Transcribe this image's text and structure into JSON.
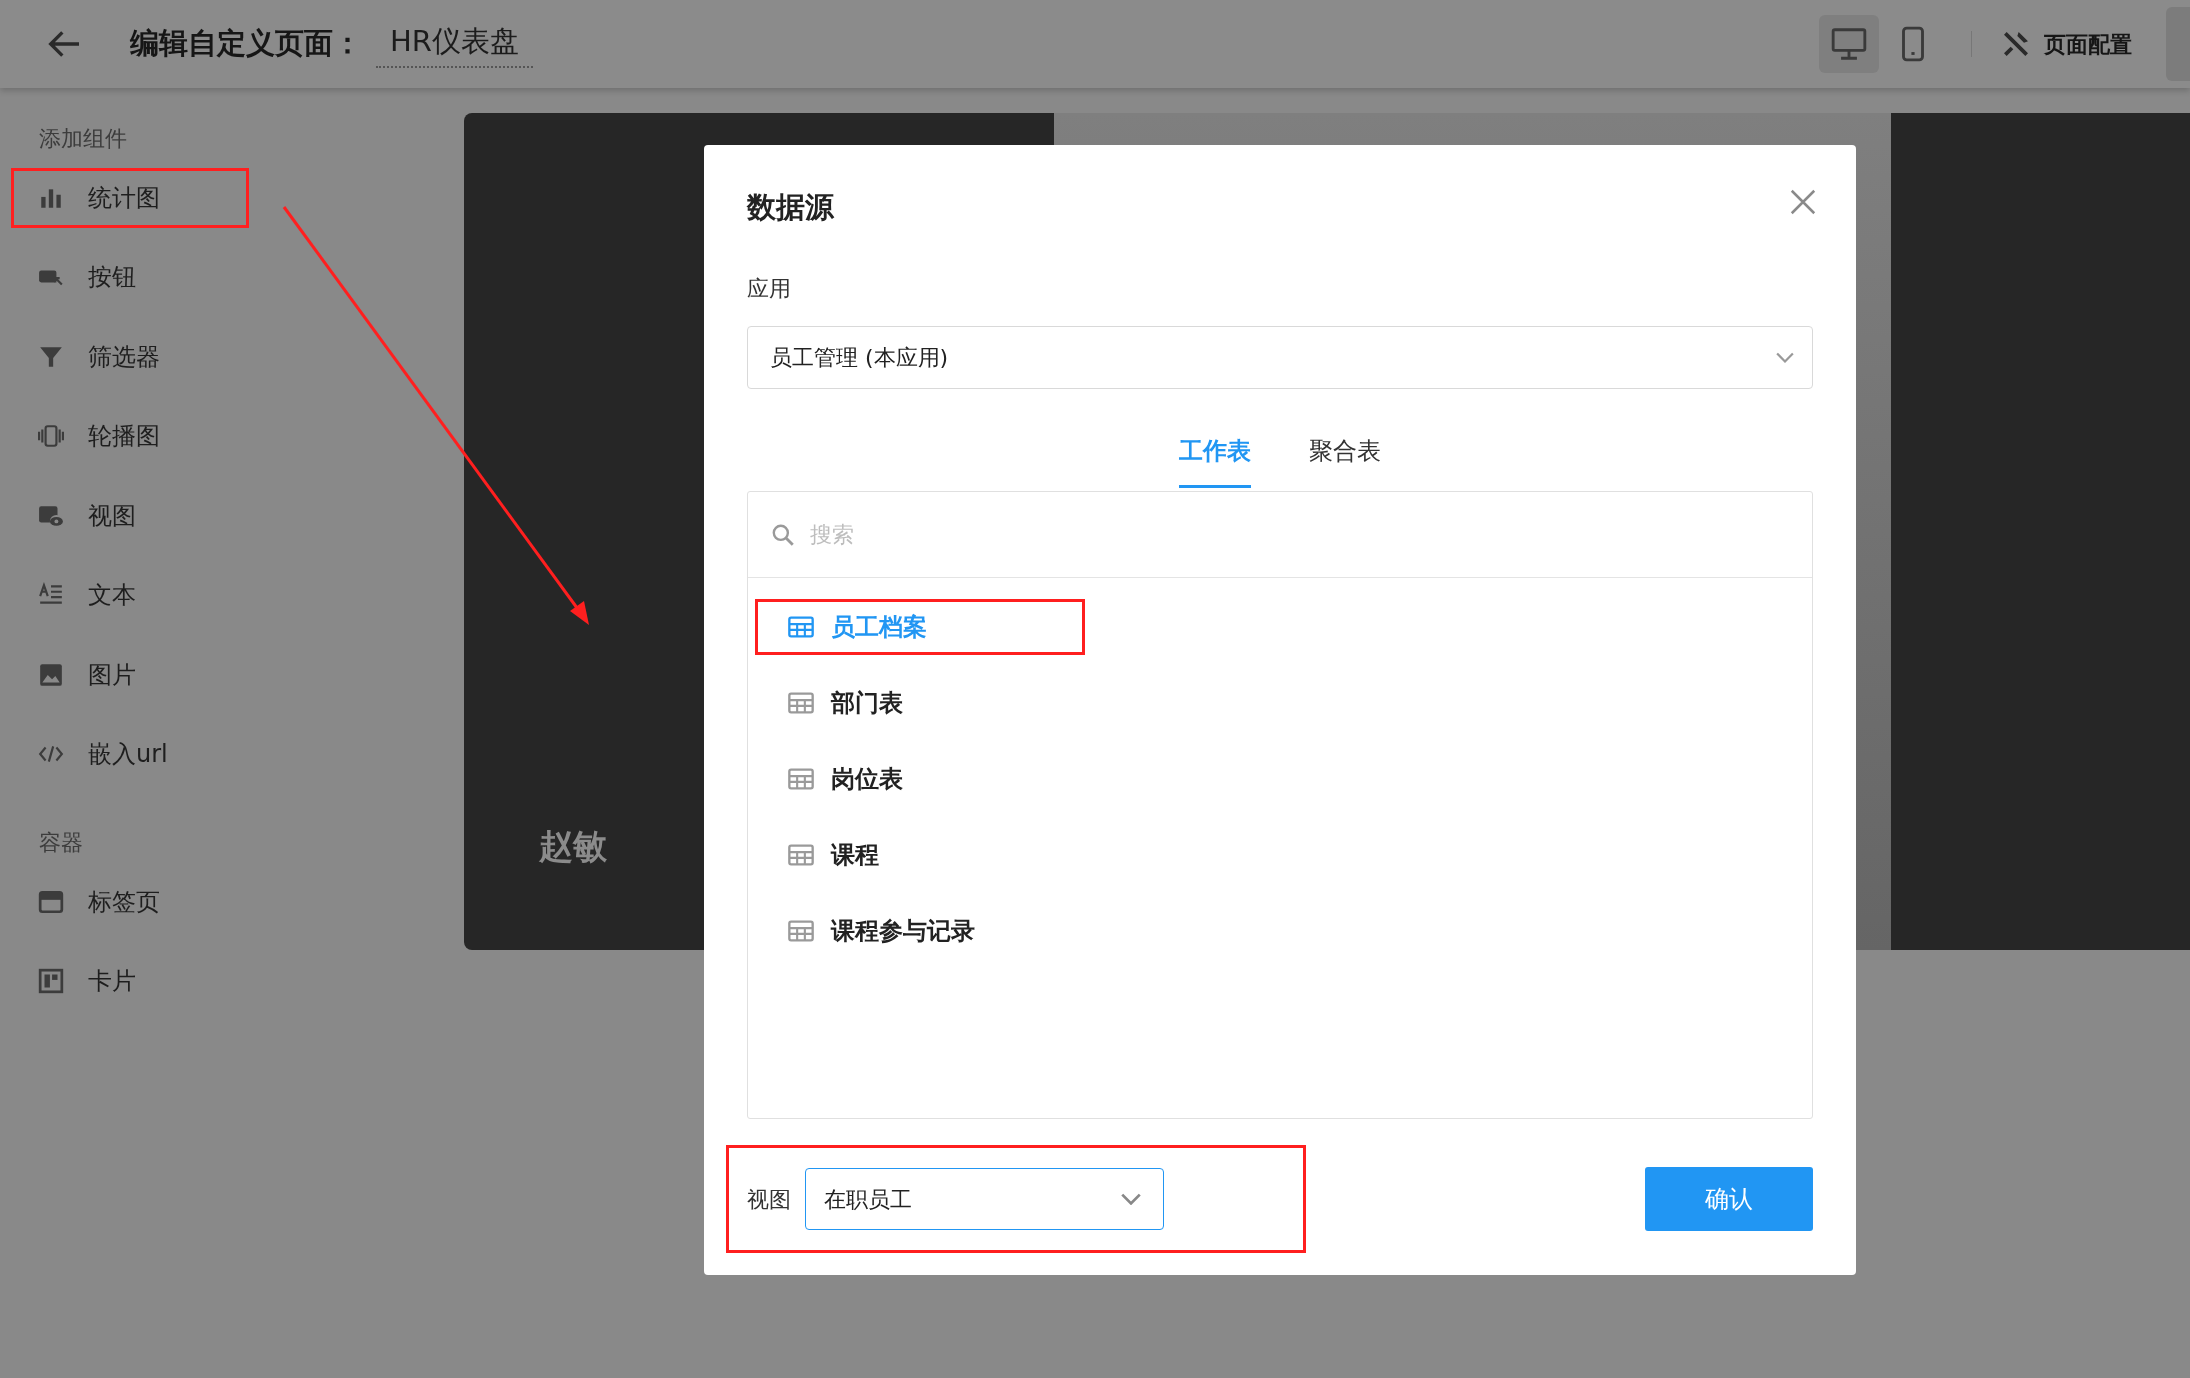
{
  "top_bar": {
    "title": "编辑自定义页面：",
    "page_name": "HR仪表盘",
    "device_buttons": [
      {
        "kind": "desktop",
        "selected": true
      },
      {
        "kind": "mobile",
        "selected": false
      }
    ],
    "config_button": "页面配置"
  },
  "sidebar": {
    "sections": [
      {
        "title": "添加组件",
        "items": [
          {
            "kind": "chart",
            "label": "统计图",
            "highlighted": true
          },
          {
            "kind": "button",
            "label": "按钮",
            "highlighted": false
          },
          {
            "kind": "filter",
            "label": "筛选器",
            "highlighted": false
          },
          {
            "kind": "carousel",
            "label": "轮播图",
            "highlighted": false
          },
          {
            "kind": "view",
            "label": "视图",
            "highlighted": false
          },
          {
            "kind": "text",
            "label": "文本",
            "highlighted": false
          },
          {
            "kind": "image",
            "label": "图片",
            "highlighted": false
          },
          {
            "kind": "embed",
            "label": "嵌入url",
            "highlighted": false
          }
        ]
      },
      {
        "title": "容器",
        "items": [
          {
            "kind": "tabs",
            "label": "标签页",
            "highlighted": false
          },
          {
            "kind": "card",
            "label": "卡片",
            "highlighted": false
          }
        ]
      }
    ]
  },
  "canvas": {
    "caption": "赵敏"
  },
  "dialog": {
    "title": "数据源",
    "app_label": "应用",
    "app_value": "员工管理 (本应用)",
    "tabs": [
      {
        "label": "工作表",
        "selected": true
      },
      {
        "label": "聚合表",
        "selected": false
      }
    ],
    "search": {
      "placeholder": "搜索"
    },
    "worksheets": [
      {
        "label": "员工档案",
        "selected": true,
        "highlighted": true
      },
      {
        "label": "部门表",
        "selected": false,
        "highlighted": false
      },
      {
        "label": "岗位表",
        "selected": false,
        "highlighted": false
      },
      {
        "label": "课程",
        "selected": false,
        "highlighted": false
      },
      {
        "label": "课程参与记录",
        "selected": false,
        "highlighted": false
      }
    ],
    "view": {
      "label": "视图",
      "value": "在职员工",
      "highlighted": true
    },
    "confirm_button": "确认"
  }
}
